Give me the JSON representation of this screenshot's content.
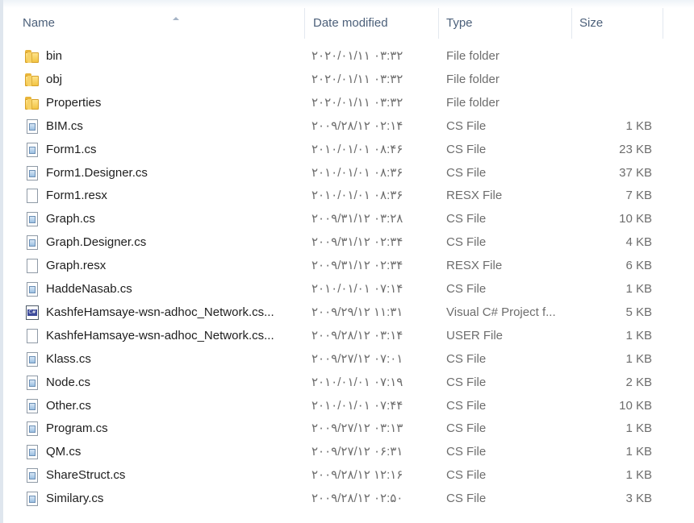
{
  "columns": {
    "name": "Name",
    "date_modified": "Date modified",
    "type": "Type",
    "size": "Size"
  },
  "files": [
    {
      "icon": "folder-icon",
      "name": "bin",
      "date": "۲۰۲۰/۰۱/۱۱ ۰۳:۳۲",
      "type": "File folder",
      "size": ""
    },
    {
      "icon": "folder-icon",
      "name": "obj",
      "date": "۲۰۲۰/۰۱/۱۱ ۰۳:۳۲",
      "type": "File folder",
      "size": ""
    },
    {
      "icon": "folder-icon",
      "name": "Properties",
      "date": "۲۰۲۰/۰۱/۱۱ ۰۳:۳۲",
      "type": "File folder",
      "size": ""
    },
    {
      "icon": "cs-file-icon",
      "name": "BIM.cs",
      "date": "۲۰۰۹/۲۸/۱۲ ۰۲:۱۴",
      "type": "CS File",
      "size": "1 KB"
    },
    {
      "icon": "cs-file-icon",
      "name": "Form1.cs",
      "date": "۲۰۱۰/۰۱/۰۱ ۰۸:۴۶",
      "type": "CS File",
      "size": "23 KB"
    },
    {
      "icon": "cs-file-icon",
      "name": "Form1.Designer.cs",
      "date": "۲۰۱۰/۰۱/۰۱ ۰۸:۳۶",
      "type": "CS File",
      "size": "37 KB"
    },
    {
      "icon": "document-icon",
      "name": "Form1.resx",
      "date": "۲۰۱۰/۰۱/۰۱ ۰۸:۳۶",
      "type": "RESX File",
      "size": "7 KB"
    },
    {
      "icon": "cs-file-icon",
      "name": "Graph.cs",
      "date": "۲۰۰۹/۳۱/۱۲ ۰۳:۲۸",
      "type": "CS File",
      "size": "10 KB"
    },
    {
      "icon": "cs-file-icon",
      "name": "Graph.Designer.cs",
      "date": "۲۰۰۹/۳۱/۱۲ ۰۲:۳۴",
      "type": "CS File",
      "size": "4 KB"
    },
    {
      "icon": "document-icon",
      "name": "Graph.resx",
      "date": "۲۰۰۹/۳۱/۱۲ ۰۲:۳۴",
      "type": "RESX File",
      "size": "6 KB"
    },
    {
      "icon": "cs-file-icon",
      "name": "HaddeNasab.cs",
      "date": "۲۰۱۰/۰۱/۰۱ ۰۷:۱۴",
      "type": "CS File",
      "size": "1 KB"
    },
    {
      "icon": "csharp-project-icon",
      "name": "KashfeHamsaye-wsn-adhoc_Network.cs...",
      "date": "۲۰۰۹/۲۹/۱۲ ۱۱:۳۱",
      "type": "Visual C# Project f...",
      "size": "5 KB"
    },
    {
      "icon": "document-icon",
      "name": "KashfeHamsaye-wsn-adhoc_Network.cs...",
      "date": "۲۰۰۹/۲۸/۱۲ ۰۳:۱۴",
      "type": "USER File",
      "size": "1 KB"
    },
    {
      "icon": "cs-file-icon",
      "name": "Klass.cs",
      "date": "۲۰۰۹/۲۷/۱۲ ۰۷:۰۱",
      "type": "CS File",
      "size": "1 KB"
    },
    {
      "icon": "cs-file-icon",
      "name": "Node.cs",
      "date": "۲۰۱۰/۰۱/۰۱ ۰۷:۱۹",
      "type": "CS File",
      "size": "2 KB"
    },
    {
      "icon": "cs-file-icon",
      "name": "Other.cs",
      "date": "۲۰۱۰/۰۱/۰۱ ۰۷:۴۴",
      "type": "CS File",
      "size": "10 KB"
    },
    {
      "icon": "cs-file-icon",
      "name": "Program.cs",
      "date": "۲۰۰۹/۲۷/۱۲ ۰۳:۱۳",
      "type": "CS File",
      "size": "1 KB"
    },
    {
      "icon": "cs-file-icon",
      "name": "QM.cs",
      "date": "۲۰۰۹/۲۷/۱۲ ۰۶:۳۱",
      "type": "CS File",
      "size": "1 KB"
    },
    {
      "icon": "cs-file-icon",
      "name": "ShareStruct.cs",
      "date": "۲۰۰۹/۲۸/۱۲ ۱۲:۱۶",
      "type": "CS File",
      "size": "1 KB"
    },
    {
      "icon": "cs-file-icon",
      "name": "Similary.cs",
      "date": "۲۰۰۹/۲۸/۱۲ ۰۲:۵۰",
      "type": "CS File",
      "size": "3 KB"
    }
  ]
}
